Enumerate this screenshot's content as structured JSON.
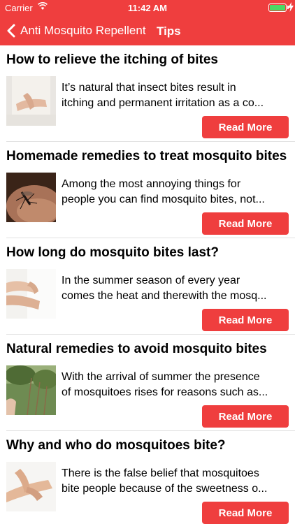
{
  "status": {
    "carrier": "Carrier",
    "time": "11:42 AM"
  },
  "nav": {
    "back_label": "Anti Mosquito Repellent",
    "title": "Tips"
  },
  "colors": {
    "accent": "#ef3e3e",
    "battery": "#4cd964"
  },
  "articles": [
    {
      "title": "How to relieve the itching of bites",
      "excerpt_lines": [
        "It’s natural that insect bites result in",
        "itching and permanent irritation as a co..."
      ],
      "button": "Read More",
      "thumbnail": "itchy-arm-photo"
    },
    {
      "title": "Homemade remedies to treat mosquito bites",
      "excerpt_lines": [
        "Among the most annoying things for",
        "people you can find mosquito bites, not..."
      ],
      "button": "Read More",
      "thumbnail": "mosquito-on-skin-photo"
    },
    {
      "title": "How long do mosquito bites last?",
      "excerpt_lines": [
        "In the summer season of every year",
        "comes the heat and therewith the mosq..."
      ],
      "button": "Read More",
      "thumbnail": "scratching-arm-photo"
    },
    {
      "title": "Natural remedies to avoid mosquito bites",
      "excerpt_lines": [
        "With the arrival of summer the presence",
        "of mosquitoes rises for reasons such as..."
      ],
      "button": "Read More",
      "thumbnail": "garden-plants-photo"
    },
    {
      "title": "Why and who do mosquitoes bite?",
      "excerpt_lines": [
        "There is the false belief that mosquitoes",
        "bite people because of the sweetness o..."
      ],
      "button": "Read More",
      "thumbnail": "hand-on-wrist-photo"
    }
  ]
}
